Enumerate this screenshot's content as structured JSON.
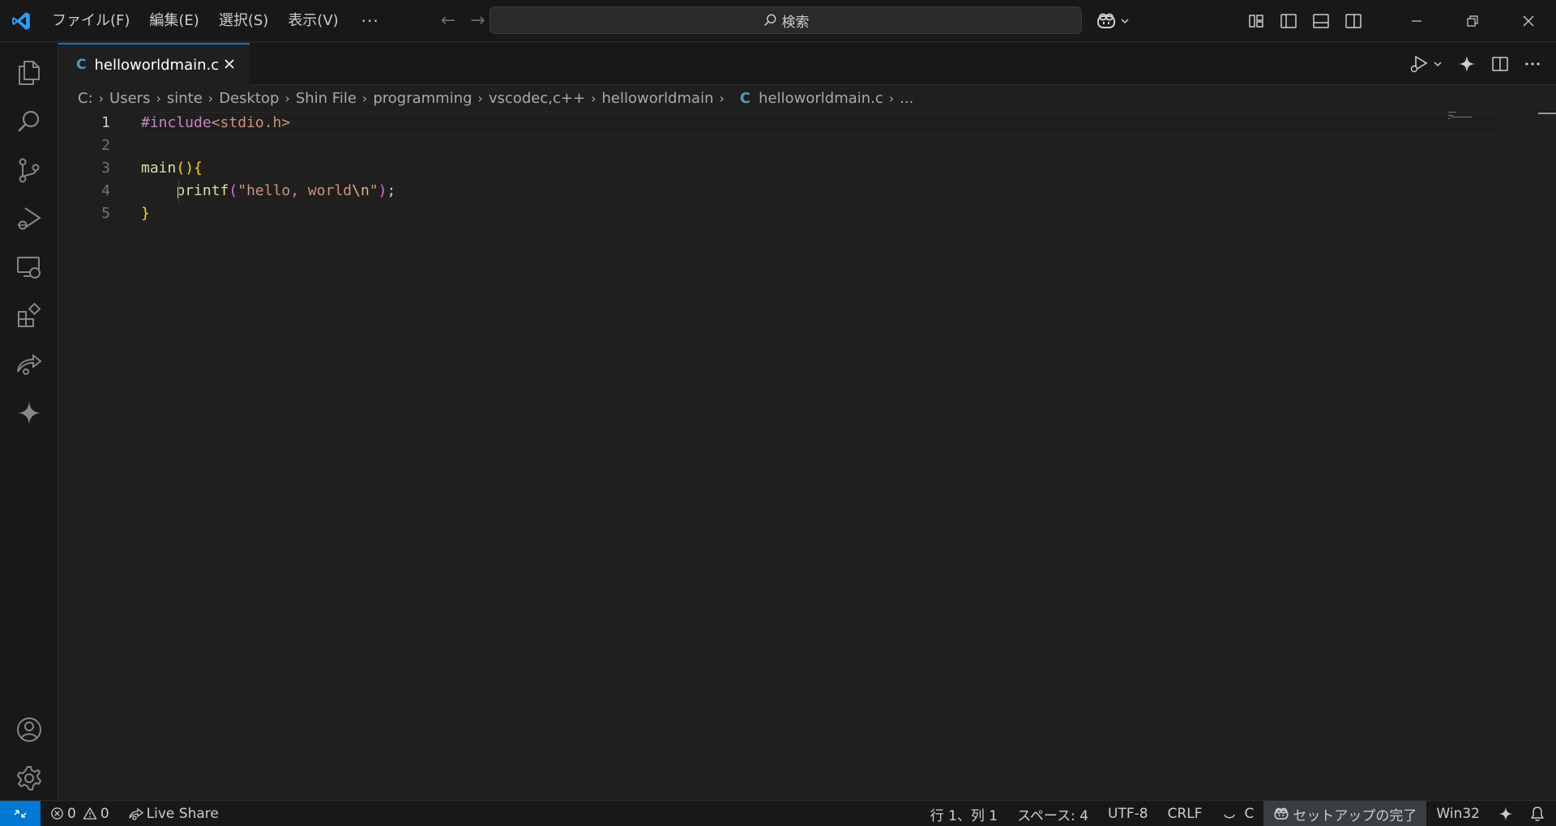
{
  "titlebar": {
    "menu": [
      "ファイル(F)",
      "編集(E)",
      "選択(S)",
      "表示(V)"
    ],
    "more": "···",
    "back": "←",
    "forward": "→",
    "search_label": "検索"
  },
  "tab": {
    "icon_letter": "C",
    "name": "helloworldmain.c",
    "close": "✕"
  },
  "breadcrumb": {
    "parts": [
      "C:",
      "Users",
      "sinte",
      "Desktop",
      "Shin File",
      "programming",
      "vscodec,c++",
      "helloworldmain"
    ],
    "file_icon": "C",
    "file": "helloworldmain.c",
    "ellipsis": "..."
  },
  "editor": {
    "line_numbers": [
      "1",
      "2",
      "3",
      "4",
      "5"
    ],
    "l1": {
      "directive": "#include",
      "header": "<stdio.h>"
    },
    "l3": {
      "fn": "main",
      "paren": "()",
      "brace": "{"
    },
    "l4": {
      "indent": "    ",
      "fn": "printf",
      "open": "(",
      "str1": "\"hello, world",
      "esc": "\\n",
      "str2": "\"",
      "close": ")",
      "semi": ";"
    },
    "l5": {
      "brace": "}"
    }
  },
  "statusbar": {
    "errors": "0",
    "warnings": "0",
    "live_share": "Live Share",
    "position": "行 1、列 1",
    "spaces": "スペース: 4",
    "encoding": "UTF-8",
    "eol": "CRLF",
    "language": "C",
    "setup": "セットアップの完了",
    "platform": "Win32"
  },
  "colors": {
    "accent": "#0078d4",
    "background": "#1f1f1f",
    "chrome": "#181818"
  }
}
